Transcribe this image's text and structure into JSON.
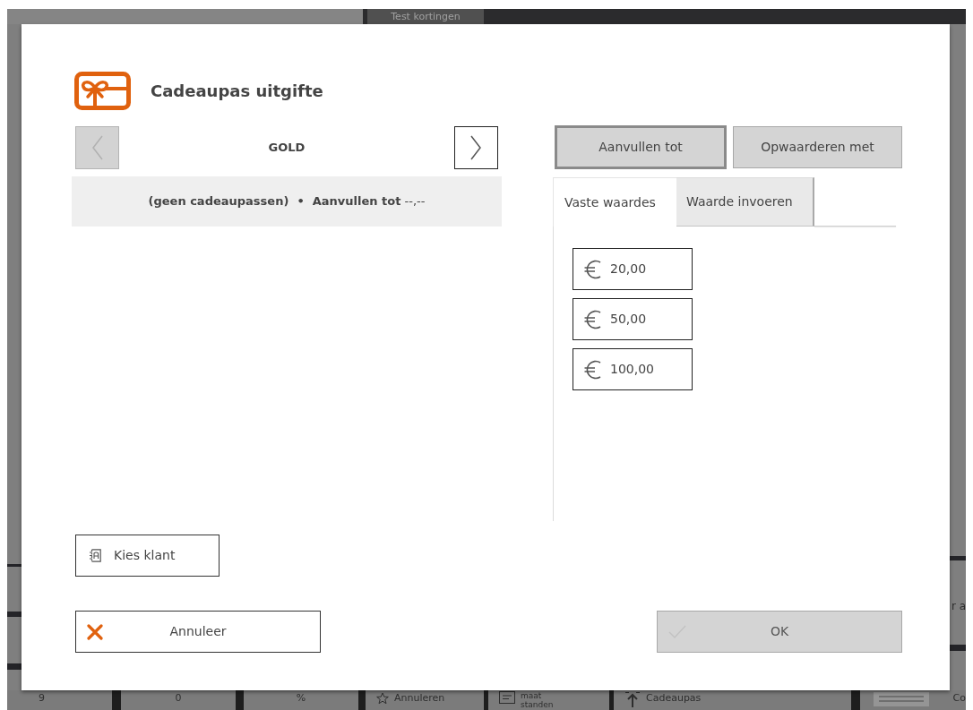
{
  "background": {
    "top_tab": "Test kortingen",
    "side_text": "r a",
    "bottom_tiles": [
      {
        "kind": "plain",
        "label": "9"
      },
      {
        "kind": "plain",
        "label": "0"
      },
      {
        "kind": "plain",
        "label": "%"
      },
      {
        "kind": "star",
        "label": "Annuleren"
      },
      {
        "kind": "document",
        "label": "maat standen"
      },
      {
        "kind": "upload",
        "label": "Cadeaupas"
      },
      {
        "kind": "lines",
        "label": "Co"
      }
    ]
  },
  "dialog": {
    "title": "Cadeaupas uitgifte",
    "card_type": {
      "label": "GOLD",
      "prev_disabled": true,
      "next_disabled": false
    },
    "summary": "**(geen cadeaupassen)  •  Aanvullen tot** --,--",
    "modes": [
      {
        "label": "Aanvullen tot",
        "selected": true
      },
      {
        "label": "Opwaarderen met",
        "selected": false
      }
    ],
    "tabs": [
      {
        "label": "Vaste waardes",
        "selected": true
      },
      {
        "label": "Waarde invoeren",
        "selected": false
      }
    ],
    "fixed_values": [
      "20,00",
      "50,00",
      "100,00"
    ],
    "choose_customer_button": "Kies klant",
    "cancel_button": "Annuleer",
    "ok_button": {
      "label": "OK",
      "disabled": true
    }
  }
}
